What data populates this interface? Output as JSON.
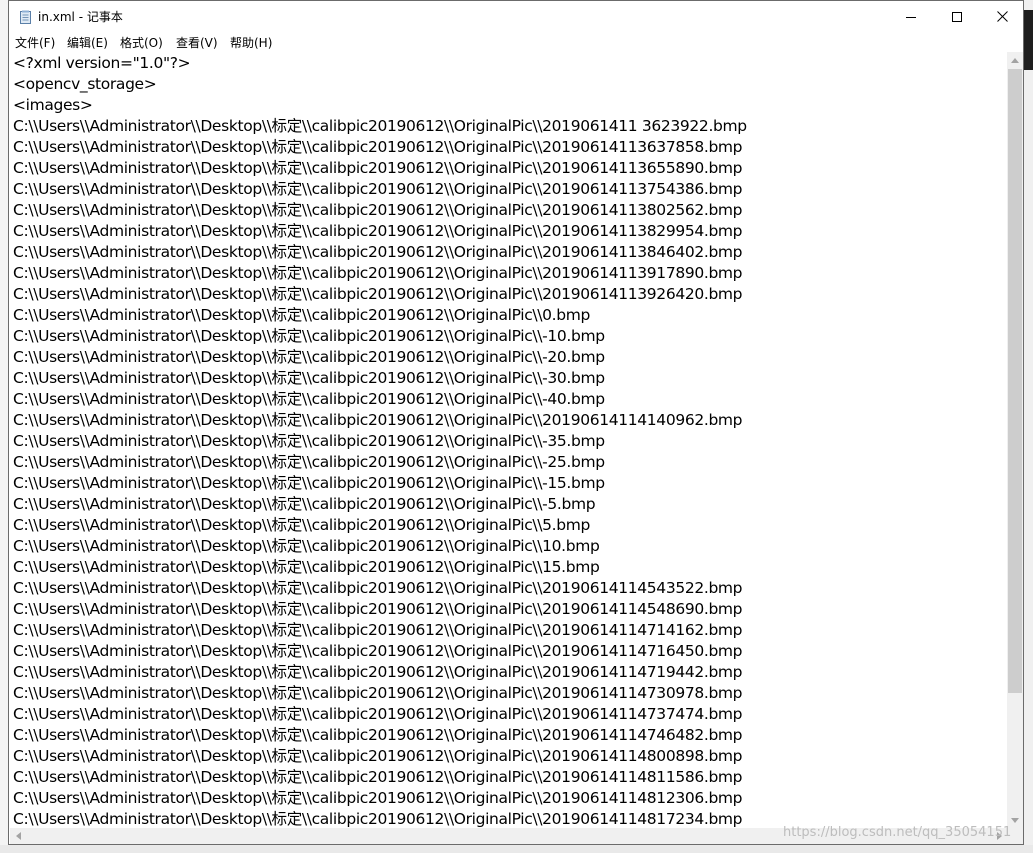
{
  "window": {
    "title": "in.xml - 记事本",
    "controls": {
      "minimize": "minimize",
      "maximize": "maximize",
      "close": "close"
    }
  },
  "menu": [
    {
      "label": "文件(F)"
    },
    {
      "label": "编辑(E)"
    },
    {
      "label": "格式(O)"
    },
    {
      "label": "查看(V)"
    },
    {
      "label": "帮助(H)"
    }
  ],
  "document": {
    "lines": [
      "<?xml version=\"1.0\"?>",
      "<opencv_storage>",
      "<images>",
      "C:\\\\Users\\\\Administrator\\\\Desktop\\\\标定\\\\calibpic20190612\\\\OriginalPic\\\\2019061411 3623922.bmp",
      "C:\\\\Users\\\\Administrator\\\\Desktop\\\\标定\\\\calibpic20190612\\\\OriginalPic\\\\20190614113637858.bmp",
      "C:\\\\Users\\\\Administrator\\\\Desktop\\\\标定\\\\calibpic20190612\\\\OriginalPic\\\\20190614113655890.bmp",
      "C:\\\\Users\\\\Administrator\\\\Desktop\\\\标定\\\\calibpic20190612\\\\OriginalPic\\\\20190614113754386.bmp",
      "C:\\\\Users\\\\Administrator\\\\Desktop\\\\标定\\\\calibpic20190612\\\\OriginalPic\\\\20190614113802562.bmp",
      "C:\\\\Users\\\\Administrator\\\\Desktop\\\\标定\\\\calibpic20190612\\\\OriginalPic\\\\20190614113829954.bmp",
      "C:\\\\Users\\\\Administrator\\\\Desktop\\\\标定\\\\calibpic20190612\\\\OriginalPic\\\\20190614113846402.bmp",
      "C:\\\\Users\\\\Administrator\\\\Desktop\\\\标定\\\\calibpic20190612\\\\OriginalPic\\\\20190614113917890.bmp",
      "C:\\\\Users\\\\Administrator\\\\Desktop\\\\标定\\\\calibpic20190612\\\\OriginalPic\\\\20190614113926420.bmp",
      "C:\\\\Users\\\\Administrator\\\\Desktop\\\\标定\\\\calibpic20190612\\\\OriginalPic\\\\0.bmp",
      "C:\\\\Users\\\\Administrator\\\\Desktop\\\\标定\\\\calibpic20190612\\\\OriginalPic\\\\-10.bmp",
      "C:\\\\Users\\\\Administrator\\\\Desktop\\\\标定\\\\calibpic20190612\\\\OriginalPic\\\\-20.bmp",
      "C:\\\\Users\\\\Administrator\\\\Desktop\\\\标定\\\\calibpic20190612\\\\OriginalPic\\\\-30.bmp",
      "C:\\\\Users\\\\Administrator\\\\Desktop\\\\标定\\\\calibpic20190612\\\\OriginalPic\\\\-40.bmp",
      "C:\\\\Users\\\\Administrator\\\\Desktop\\\\标定\\\\calibpic20190612\\\\OriginalPic\\\\20190614114140962.bmp",
      "C:\\\\Users\\\\Administrator\\\\Desktop\\\\标定\\\\calibpic20190612\\\\OriginalPic\\\\-35.bmp",
      "C:\\\\Users\\\\Administrator\\\\Desktop\\\\标定\\\\calibpic20190612\\\\OriginalPic\\\\-25.bmp",
      "C:\\\\Users\\\\Administrator\\\\Desktop\\\\标定\\\\calibpic20190612\\\\OriginalPic\\\\-15.bmp",
      "C:\\\\Users\\\\Administrator\\\\Desktop\\\\标定\\\\calibpic20190612\\\\OriginalPic\\\\-5.bmp",
      "C:\\\\Users\\\\Administrator\\\\Desktop\\\\标定\\\\calibpic20190612\\\\OriginalPic\\\\5.bmp",
      "C:\\\\Users\\\\Administrator\\\\Desktop\\\\标定\\\\calibpic20190612\\\\OriginalPic\\\\10.bmp",
      "C:\\\\Users\\\\Administrator\\\\Desktop\\\\标定\\\\calibpic20190612\\\\OriginalPic\\\\15.bmp",
      "C:\\\\Users\\\\Administrator\\\\Desktop\\\\标定\\\\calibpic20190612\\\\OriginalPic\\\\20190614114543522.bmp",
      "C:\\\\Users\\\\Administrator\\\\Desktop\\\\标定\\\\calibpic20190612\\\\OriginalPic\\\\20190614114548690.bmp",
      "C:\\\\Users\\\\Administrator\\\\Desktop\\\\标定\\\\calibpic20190612\\\\OriginalPic\\\\20190614114714162.bmp",
      "C:\\\\Users\\\\Administrator\\\\Desktop\\\\标定\\\\calibpic20190612\\\\OriginalPic\\\\20190614114716450.bmp",
      "C:\\\\Users\\\\Administrator\\\\Desktop\\\\标定\\\\calibpic20190612\\\\OriginalPic\\\\20190614114719442.bmp",
      "C:\\\\Users\\\\Administrator\\\\Desktop\\\\标定\\\\calibpic20190612\\\\OriginalPic\\\\20190614114730978.bmp",
      "C:\\\\Users\\\\Administrator\\\\Desktop\\\\标定\\\\calibpic20190612\\\\OriginalPic\\\\20190614114737474.bmp",
      "C:\\\\Users\\\\Administrator\\\\Desktop\\\\标定\\\\calibpic20190612\\\\OriginalPic\\\\20190614114746482.bmp",
      "C:\\\\Users\\\\Administrator\\\\Desktop\\\\标定\\\\calibpic20190612\\\\OriginalPic\\\\20190614114800898.bmp",
      "C:\\\\Users\\\\Administrator\\\\Desktop\\\\标定\\\\calibpic20190612\\\\OriginalPic\\\\20190614114811586.bmp",
      "C:\\\\Users\\\\Administrator\\\\Desktop\\\\标定\\\\calibpic20190612\\\\OriginalPic\\\\20190614114812306.bmp",
      "C:\\\\Users\\\\Administrator\\\\Desktop\\\\标定\\\\calibpic20190612\\\\OriginalPic\\\\20190614114817234.bmp"
    ]
  },
  "watermark": "https://blog.csdn.net/qq_35054151",
  "icons": {
    "app": "notepad-icon",
    "scroll_up": "arrow-up-icon",
    "scroll_down": "arrow-down-icon",
    "scroll_left": "arrow-left-icon",
    "scroll_right": "arrow-right-icon"
  },
  "colors": {
    "window_bg": "#ffffff",
    "text": "#000000",
    "scrollbar_track": "#f0f0f0",
    "scrollbar_thumb": "#cdcdcd"
  }
}
